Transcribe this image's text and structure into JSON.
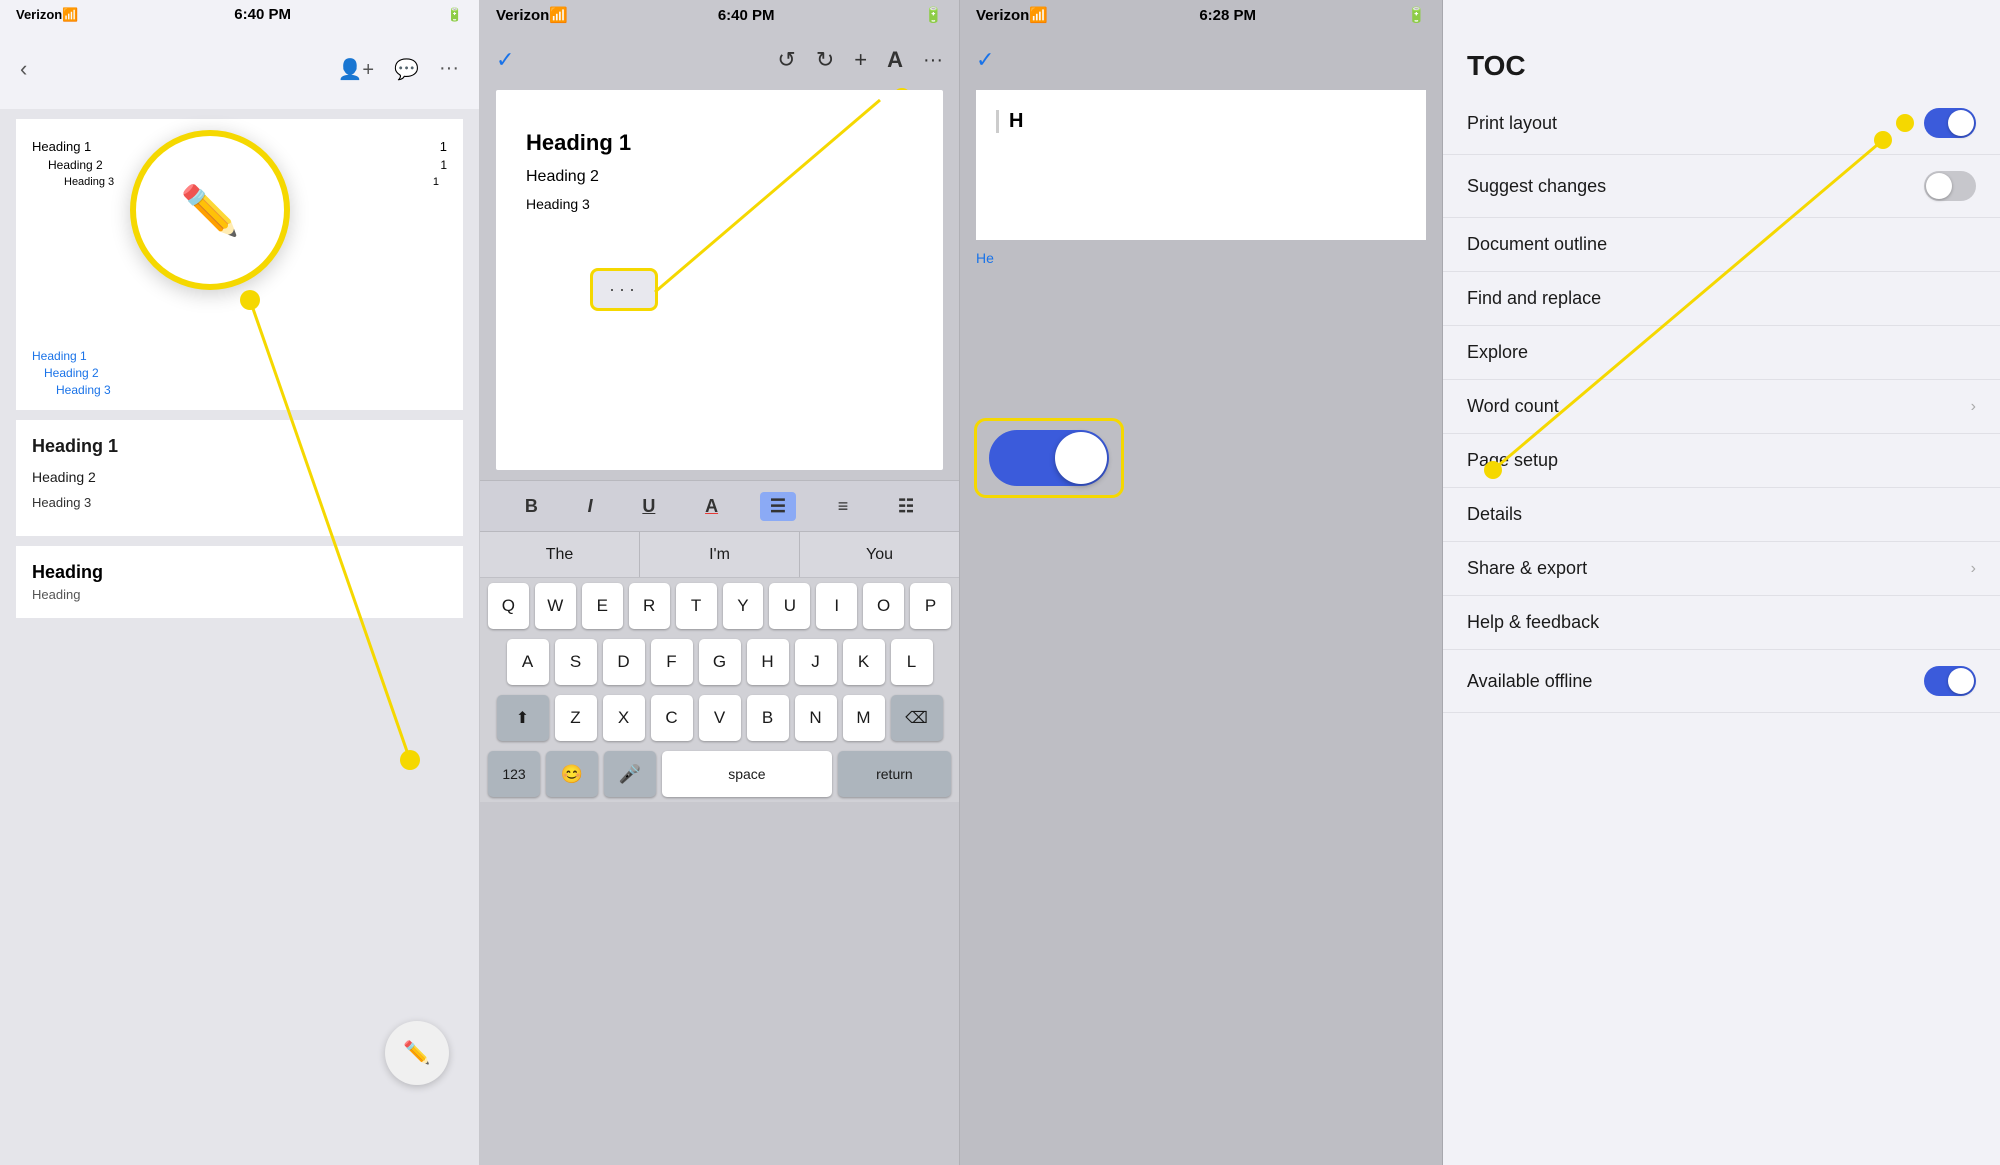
{
  "panel1": {
    "status": {
      "carrier": "Verizon",
      "wifi": "WiFi",
      "time": "6:40 PM",
      "battery": "🔋"
    },
    "toc_entries": [
      {
        "level": "h1",
        "label": "Heading 1",
        "page": "1"
      },
      {
        "level": "h2",
        "label": "Heading 2",
        "page": "1"
      },
      {
        "level": "h3",
        "label": "Heading 3",
        "page": ""
      }
    ],
    "toc_links": [
      {
        "level": "h1",
        "label": "Heading 1"
      },
      {
        "level": "h2",
        "label": "Heading 2"
      },
      {
        "level": "h3",
        "label": "Heading 3"
      }
    ],
    "headings": [
      {
        "level": "h1",
        "label": "Heading 1"
      },
      {
        "level": "h2",
        "label": "Heading 2"
      },
      {
        "level": "h3",
        "label": "Heading 3"
      }
    ],
    "footer_heading": "Heading",
    "footer_sublabel": "Heading",
    "fab_big_tooltip": "Edit",
    "fab_small_tooltip": "Edit"
  },
  "panel2": {
    "status": {
      "carrier": "Verizon",
      "wifi": "WiFi",
      "time": "6:40 PM",
      "battery": "🔋"
    },
    "toolbar": {
      "check": "✓",
      "undo": "↺",
      "redo": "↻",
      "add": "+",
      "text_format": "A",
      "more": "···"
    },
    "headings": [
      {
        "label": "Heading 1"
      },
      {
        "label": "Heading 2"
      },
      {
        "label": "Heading 3"
      }
    ],
    "three_dots": "···",
    "autocomplete": [
      "The",
      "I'm",
      "You"
    ],
    "format_buttons": [
      "B",
      "I",
      "U",
      "A",
      "≡",
      "≡",
      "≡"
    ],
    "keyboard_rows": [
      [
        "Q",
        "W",
        "E",
        "R",
        "T",
        "Y",
        "U",
        "I",
        "O",
        "P"
      ],
      [
        "A",
        "S",
        "D",
        "F",
        "G",
        "H",
        "J",
        "K",
        "L"
      ],
      [
        "shift",
        "Z",
        "X",
        "C",
        "V",
        "B",
        "N",
        "M",
        "del"
      ],
      [
        "123",
        "emoji",
        "mic",
        "space",
        "return"
      ]
    ]
  },
  "panel3": {
    "status": {
      "carrier": "Verizon",
      "wifi": "WiFi",
      "time": "6:28 PM",
      "battery": "🔋"
    },
    "toolbar": {
      "check": "✓"
    },
    "doc_heading": "H",
    "blue_label": "He"
  },
  "panel4": {
    "title": "TOC",
    "items": [
      {
        "label": "Print layout",
        "type": "toggle",
        "state": "on"
      },
      {
        "label": "Suggest changes",
        "type": "toggle",
        "state": "off"
      },
      {
        "label": "Document outline",
        "type": "action"
      },
      {
        "label": "Find and replace",
        "type": "action"
      },
      {
        "label": "Explore",
        "type": "action"
      },
      {
        "label": "Word count",
        "type": "chevron"
      },
      {
        "label": "Page setup",
        "type": "action"
      },
      {
        "label": "Details",
        "type": "action"
      },
      {
        "label": "Share & export",
        "type": "chevron"
      },
      {
        "label": "Help & feedback",
        "type": "action"
      },
      {
        "label": "Available offline",
        "type": "toggle",
        "state": "on"
      }
    ],
    "annotation_dot_label": "Print layout toggle dot"
  }
}
